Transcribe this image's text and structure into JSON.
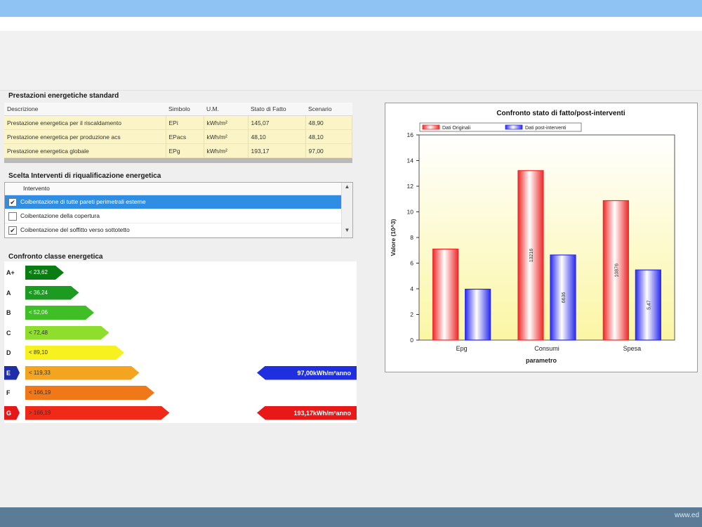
{
  "footer": {
    "watermark": "www.ed"
  },
  "standard_section": {
    "title": "Prestazioni energetiche standard",
    "columns": [
      "Descrizione",
      "Simbolo",
      "U.M.",
      "Stato di Fatto",
      "Scenario"
    ],
    "rows": [
      [
        "Prestazione energetica per il riscaldamento",
        "EPi",
        "kWh/m²",
        "145,07",
        "48,90"
      ],
      [
        "Prestazione energetica per produzione acs",
        "EPacs",
        "kWh/m²",
        "48,10",
        "48,10"
      ],
      [
        "Prestazione energetica globale",
        "EPg",
        "kWh/m²",
        "193,17",
        "97,00"
      ]
    ]
  },
  "interventions": {
    "title": "Scelta Interventi di riqualificazione energetica",
    "header": "Intervento",
    "items": [
      {
        "label": "Coibentazione di tutte pareti perimetrali esterne",
        "checked": true,
        "selected": true
      },
      {
        "label": "Coibentazione della copertura",
        "checked": false,
        "selected": false
      },
      {
        "label": "Coibentazione del soffitto verso sottotetto",
        "checked": true,
        "selected": false
      }
    ]
  },
  "energy_class": {
    "title": "Confronto classe energetica",
    "classes": [
      {
        "letter": "A+",
        "range": "< 23,62",
        "color": "#0a7d12",
        "text_color": "#ffffff"
      },
      {
        "letter": "A",
        "range": "< 36,24",
        "color": "#1c9a22",
        "text_color": "#ffffff"
      },
      {
        "letter": "B",
        "range": "< 52,06",
        "color": "#3fbe26",
        "text_color": "#ffffff"
      },
      {
        "letter": "C",
        "range": "< 72,48",
        "color": "#8fdd2c",
        "text_color": "#333333"
      },
      {
        "letter": "D",
        "range": "< 89,10",
        "color": "#f6f11f",
        "text_color": "#333333"
      },
      {
        "letter": "E",
        "range": "< 119,33",
        "color": "#f4a51f",
        "text_color": "#333333"
      },
      {
        "letter": "F",
        "range": "< 166,19",
        "color": "#f07818",
        "text_color": "#333333"
      },
      {
        "letter": "G",
        "range": "> 166,19",
        "color": "#ef2a18",
        "text_color": "#333333"
      }
    ],
    "scenario_result": {
      "label": "97,00kWh/m²anno",
      "class": "E",
      "color": "#1f2fe0"
    },
    "current_result": {
      "label": "193,17kWh/m²anno",
      "class": "G",
      "color": "#e81818"
    }
  },
  "chart_data": {
    "type": "bar",
    "title": "Confronto stato di fatto/post-interventi",
    "xlabel": "parametro",
    "ylabel": "Valore (10^3)",
    "ylim": [
      0,
      16
    ],
    "yticks": [
      0,
      2,
      4,
      6,
      8,
      10,
      12,
      14,
      16
    ],
    "categories": [
      "Epg",
      "Consumi",
      "Spesa"
    ],
    "legend_position": "top",
    "series": [
      {
        "name": "Dati Originali",
        "values": [
          7.1,
          13.216,
          10.876
        ],
        "labels": [
          "",
          "13216",
          "10876"
        ],
        "color": "#ee2a2a"
      },
      {
        "name": "Dati post-interventi",
        "values": [
          3.97,
          6.636,
          5.47
        ],
        "labels": [
          "",
          "6636",
          "5,47"
        ],
        "color": "#2a2aee"
      }
    ]
  }
}
